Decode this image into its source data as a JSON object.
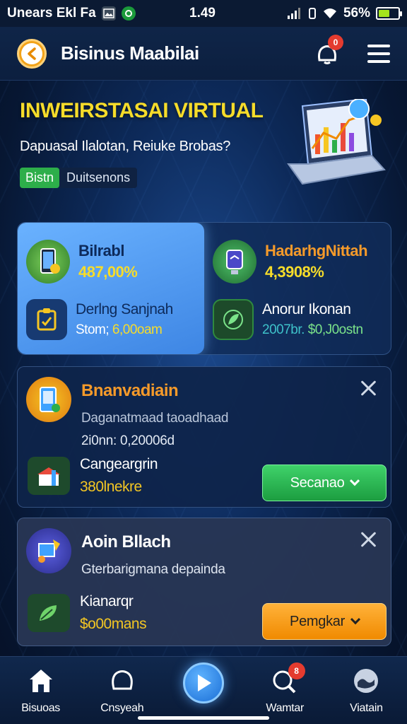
{
  "status_bar": {
    "left_text": "Unears Ekl Fa",
    "time": "1.49",
    "battery": "56%",
    "battery_level": 0.56
  },
  "header": {
    "title": "Bisinus Maabilai",
    "notification_count": "0"
  },
  "hero": {
    "title": "INWEIRSTASAI VIRTUAL",
    "subtitle": "Dapuasal Ilalotan, Reiuke Brobas?",
    "tag_green": "Bistn",
    "tag_dark": "Duitsenons"
  },
  "stats": {
    "left": {
      "title": "Bilrabl",
      "value": "487,00%",
      "sub_title": "Derlng Sanjnah",
      "sub_prefix": "Stom;",
      "sub_value": "6,00oam"
    },
    "right": {
      "title": "HadarhgNittah",
      "value": "4,3908%",
      "sub_title": "Anorur Ikonan",
      "sub_prefix": "2007br.",
      "sub_value": "$0,J0ostn"
    }
  },
  "card1": {
    "title": "Bnanvadiain",
    "subtitle": "Daganatmaad taoadhaad",
    "meta": "2i0nn: 0,20006d",
    "bottom_title": "Cangeargrin",
    "bottom_value": "380lnekre",
    "button": "Secanao"
  },
  "card2": {
    "title": "Aoin Bllach",
    "subtitle": "Gterbarigmana depainda",
    "bottom_title": "Kianarqr",
    "bottom_value": "$o00mans",
    "button": "Pemgkar"
  },
  "bottom_nav": {
    "items": [
      "Bisuoas",
      "Cnsyeah",
      "",
      "Wamtar",
      "Viatain"
    ],
    "badge": "8"
  },
  "colors": {
    "accent_yellow": "#f6dc2a",
    "green": "#2dae4a",
    "orange": "#f08a00",
    "badge_red": "#e43b2f"
  }
}
